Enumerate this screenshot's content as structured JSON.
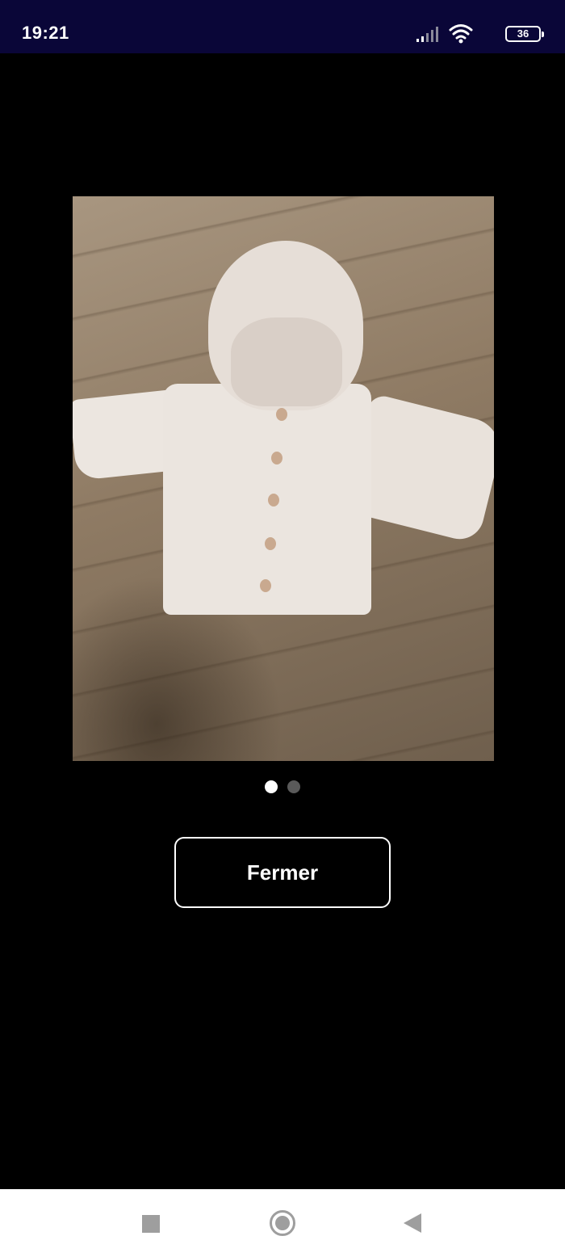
{
  "status_bar": {
    "time": "19:21",
    "battery_level": "36",
    "icons": [
      "signal-icon",
      "wifi-icon",
      "battery-icon"
    ]
  },
  "viewer": {
    "image_count": 2,
    "current_index": 1
  },
  "close_button": {
    "label": "Fermer"
  },
  "nav_bar": {
    "icons": [
      "recent-apps-icon",
      "home-icon",
      "back-icon"
    ]
  },
  "colors": {
    "status_bar_bg": "#0a0638",
    "background": "#000000",
    "button_border": "#ffffff",
    "nav_bar_bg": "#ffffff",
    "nav_icon": "#9e9e9e"
  }
}
